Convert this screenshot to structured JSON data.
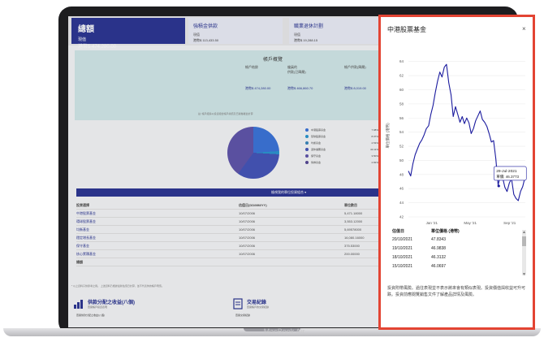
{
  "laptop_label": "MacBook Air",
  "dashboard": {
    "tab_total": {
      "title": "總額",
      "sub": "現值",
      "amount": "港幣$ 474,280.00"
    },
    "tab_mpf": {
      "title": "強積金供款",
      "sub": "現值",
      "amount": "港幣$ 113,433.50"
    },
    "tab_orso": {
      "title": "職業退休計劃",
      "sub": "現值",
      "amount": "港幣$ 19,288.15"
    },
    "summary_title": "帳戶概覽",
    "col_account": "帳戶結餘",
    "col_pre": "僱員的",
    "col_pre2": "供款(已歸屬)",
    "col_acct3": "帳戶供款(歸屬)",
    "sum_amounts": [
      "港幣$ 474,280.00",
      "港幣$ 466,860.70",
      "港幣$ 8,019.00"
    ],
    "sum_foot": "註: 帳戶結餘以投資組合帳戶總值及已歸屬權益計算",
    "legend": [
      {
        "label": "中港股票基金",
        "value": "7.98%",
        "color": "#2f6bd6"
      },
      {
        "label": "環球股票基金",
        "value": "8.07%",
        "color": "#1d8fcc"
      },
      {
        "label": "均衡基金",
        "value": "2.53%",
        "color": "#2d7fb8"
      },
      {
        "label": "退休儲蓄基金",
        "value": "40.11%",
        "color": "#3a4bb4"
      },
      {
        "label": "保守基金",
        "value": "3.50%",
        "color": "#564aa6"
      },
      {
        "label": "債券基金",
        "value": "2.82%",
        "color": "#4b3c8f"
      }
    ],
    "blue_bar_label": "檢視我的單位投資組合 ▾",
    "table_headers": [
      "投資選擇",
      "估值日(DD/MM/YY)",
      "單位數目",
      "單位價格"
    ],
    "table_rows": [
      [
        "中港股票基金",
        "10/07/2006",
        "5,471.18000",
        "港幣$ 63.54"
      ],
      [
        "環球股票基金",
        "10/07/2006",
        "3,553.12000",
        "港幣$ 50.90"
      ],
      [
        "均衡基金",
        "10/07/2006",
        "5,69578000",
        "港幣$ 21.33"
      ],
      [
        "穩定增長基金",
        "10/07/2006",
        "16,080.16000",
        "港幣$ 12.06"
      ],
      [
        "保守基金",
        "10/07/2006",
        "375.53000",
        "港幣$ 14.14"
      ],
      [
        "核心累積基金",
        "10/07/2006",
        "200.00000",
        "港幣$ 11.13"
      ]
    ],
    "table_total": "總額",
    "foot_note": "* 以上資料只供參考之用。 上述資料乃根據最新估值日計算，並不代表你的帳戶現值。",
    "card1_title": "供款分配之收益(八個)",
    "card1_sub": "查閱帳戶投資表現",
    "card1_bottom": "查閱供款分配之收益(八個)",
    "card2_title": "交易紀錄",
    "card2_sub": "查閱帳戶的交易紀錄",
    "card2_bottom": "查閱交易紀錄"
  },
  "modal": {
    "title": "中港股票基金",
    "close": "×",
    "table_headers": [
      "估值日",
      "單位價格 (港幣)"
    ],
    "table_rows": [
      [
        "20/10/2021",
        "47.8343"
      ],
      [
        "19/10/2021",
        "46.9838"
      ],
      [
        "18/10/2021",
        "46.3132"
      ],
      [
        "15/10/2021",
        "46.0697"
      ]
    ],
    "disclaimer": "投資附帶風險。過往表現並不表示將來會有類似表現。投資價值與收益可升可跌。投資前應閱覽銷售文件了解產品詳情及風險。"
  },
  "chart_data": {
    "type": "line",
    "title": "",
    "ylabel": "單位價格 (港幣)",
    "xlabel": "",
    "ylim": [
      42,
      65
    ],
    "yticks": [
      42,
      44,
      46,
      48,
      50,
      52,
      54,
      56,
      58,
      60,
      62,
      64
    ],
    "xticks": [
      {
        "date": "2021-01-01",
        "label": "Jan '21"
      },
      {
        "date": "2021-05-01",
        "label": "May '21"
      },
      {
        "date": "2021-09-01",
        "label": "Sep '21"
      }
    ],
    "xrange": [
      "2020-10-20",
      "2021-10-20"
    ],
    "line_color": "#1a1a9e",
    "tooltip": {
      "date": "29-Jul-2021",
      "label": "29-Jul-2021",
      "value_text": "單價: 46.3773",
      "value": 46.3773
    },
    "series": [
      {
        "values": [
          [
            "2020-10-20",
            48.5
          ],
          [
            "2020-10-27",
            47.8
          ],
          [
            "2020-11-03",
            49.5
          ],
          [
            "2020-11-10",
            50.8
          ],
          [
            "2020-11-17",
            51.6
          ],
          [
            "2020-11-24",
            52.4
          ],
          [
            "2020-12-01",
            52.9
          ],
          [
            "2020-12-08",
            53.6
          ],
          [
            "2020-12-15",
            54.5
          ],
          [
            "2020-12-22",
            54.9
          ],
          [
            "2020-12-29",
            56.5
          ],
          [
            "2021-01-05",
            57.8
          ],
          [
            "2021-01-12",
            59.6
          ],
          [
            "2021-01-19",
            61.2
          ],
          [
            "2021-01-26",
            62.5
          ],
          [
            "2021-02-02",
            61.8
          ],
          [
            "2021-02-09",
            63.2
          ],
          [
            "2021-02-16",
            63.6
          ],
          [
            "2021-02-23",
            61.0
          ],
          [
            "2021-03-02",
            59.3
          ],
          [
            "2021-03-09",
            56.2
          ],
          [
            "2021-03-16",
            57.6
          ],
          [
            "2021-03-23",
            56.5
          ],
          [
            "2021-03-30",
            55.4
          ],
          [
            "2021-04-06",
            56.2
          ],
          [
            "2021-04-13",
            55.2
          ],
          [
            "2021-04-20",
            56.0
          ],
          [
            "2021-04-27",
            55.3
          ],
          [
            "2021-05-04",
            53.8
          ],
          [
            "2021-05-11",
            54.5
          ],
          [
            "2021-05-18",
            55.6
          ],
          [
            "2021-05-25",
            56.3
          ],
          [
            "2021-06-01",
            57.0
          ],
          [
            "2021-06-08",
            55.8
          ],
          [
            "2021-06-15",
            55.4
          ],
          [
            "2021-06-22",
            54.8
          ],
          [
            "2021-06-29",
            53.8
          ],
          [
            "2021-07-06",
            52.6
          ],
          [
            "2021-07-13",
            52.8
          ],
          [
            "2021-07-20",
            50.2
          ],
          [
            "2021-07-27",
            46.5
          ],
          [
            "2021-08-03",
            47.9
          ],
          [
            "2021-08-10",
            47.6
          ],
          [
            "2021-08-17",
            46.2
          ],
          [
            "2021-08-24",
            45.6
          ],
          [
            "2021-08-31",
            46.8
          ],
          [
            "2021-09-07",
            47.4
          ],
          [
            "2021-09-14",
            45.2
          ],
          [
            "2021-09-21",
            44.6
          ],
          [
            "2021-09-28",
            44.3
          ],
          [
            "2021-10-05",
            45.6
          ],
          [
            "2021-10-12",
            46.3
          ],
          [
            "2021-10-20",
            47.8
          ]
        ]
      }
    ]
  }
}
